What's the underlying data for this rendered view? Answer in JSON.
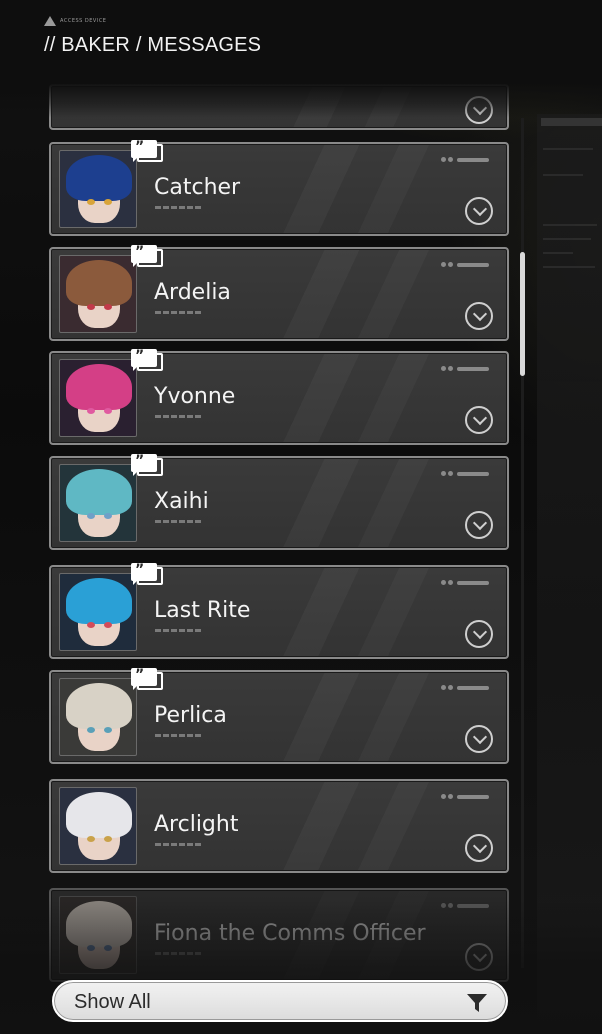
{
  "header": {
    "device_tag": "ACCESS DEVICE",
    "title": "// BAKER / MESSAGES"
  },
  "contacts": [
    {
      "name": "Catcher",
      "has_new_message": true,
      "hair": "#1d3f8f",
      "eye": "#d8a43a",
      "bg": "#2b3040"
    },
    {
      "name": "Ardelia",
      "has_new_message": true,
      "hair": "#8b5a3c",
      "eye": "#c23a4a",
      "bg": "#3a2b30"
    },
    {
      "name": "Yvonne",
      "has_new_message": true,
      "hair": "#d43f86",
      "eye": "#e05aa0",
      "bg": "#2a2030"
    },
    {
      "name": "Xaihi",
      "has_new_message": true,
      "hair": "#5fb8c4",
      "eye": "#6fa0c8",
      "bg": "#23343a"
    },
    {
      "name": "Last Rite",
      "has_new_message": true,
      "hair": "#2aa0d6",
      "eye": "#d34c5a",
      "bg": "#1f2c3c"
    },
    {
      "name": "Perlica",
      "has_new_message": true,
      "hair": "#d8d2c6",
      "eye": "#5aa0b8",
      "bg": "#3a3a38"
    },
    {
      "name": "Arclight",
      "has_new_message": false,
      "hair": "#e6e6ea",
      "eye": "#c9a24a",
      "bg": "#2a3040"
    },
    {
      "name": "Fiona the Comms Officer",
      "has_new_message": false,
      "hair": "#e6dcd2",
      "eye": "#6a8ab8",
      "bg": "#3a3634"
    }
  ],
  "filter": {
    "label": "Show All"
  }
}
